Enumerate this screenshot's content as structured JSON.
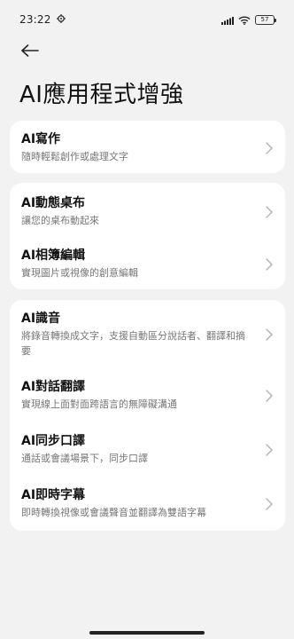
{
  "status_bar": {
    "time": "23:22",
    "battery": "57"
  },
  "header": {
    "back_icon": "back-arrow-icon",
    "title": "AI應用程式增強"
  },
  "cards": [
    {
      "items": [
        {
          "title": "AI寫作",
          "desc": "隨時輕鬆創作或處理文字"
        }
      ]
    },
    {
      "items": [
        {
          "title": "AI動態桌布",
          "desc": "讓您的桌布動起來"
        },
        {
          "title": "AI相簿編輯",
          "desc": "實現圖片或視像的創意編輯"
        }
      ]
    },
    {
      "items": [
        {
          "title": "AI識音",
          "desc": "將錄音轉換成文字，支援自動區分說話者、翻譯和摘要"
        },
        {
          "title": "AI對話翻譯",
          "desc": "實現線上面對面跨語言的無障礙溝通"
        },
        {
          "title": "AI同步口譯",
          "desc": "通話或會議場景下，同步口譯"
        },
        {
          "title": "AI即時字幕",
          "desc": "即時轉換視像或會議聲音並翻譯為雙語字幕"
        }
      ]
    }
  ],
  "colors": {
    "background": "#f2f2f2",
    "card": "#ffffff",
    "title_text": "#111111",
    "desc_text": "#777777",
    "chevron": "#b5b5b5"
  }
}
